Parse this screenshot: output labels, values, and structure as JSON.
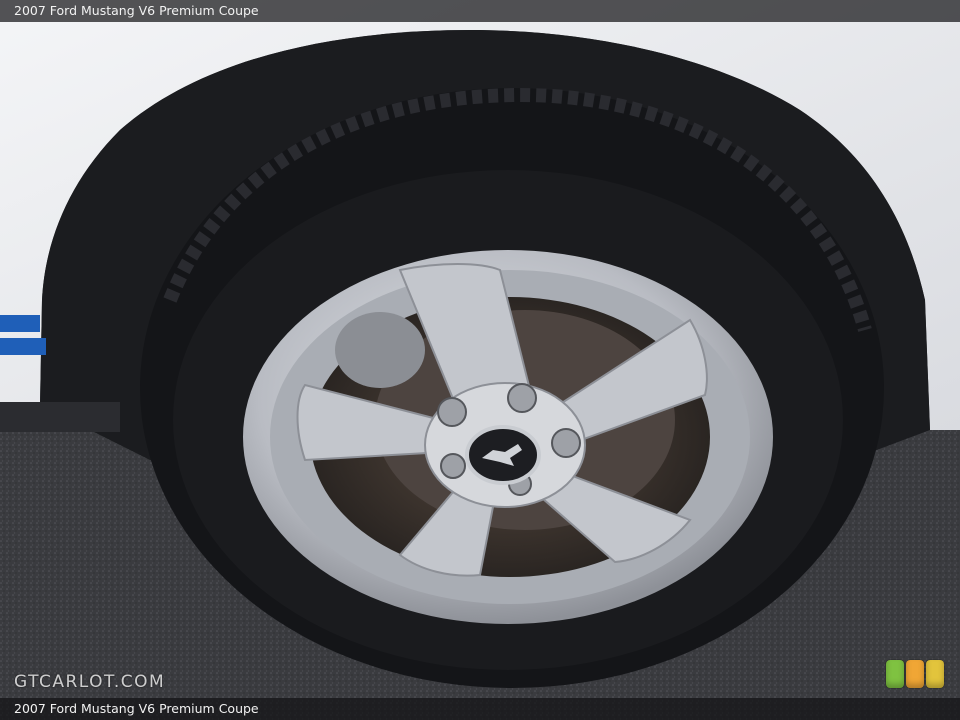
{
  "caption": {
    "title_top": "2007 Ford Mustang V6 Premium Coupe",
    "title_bottom": "2007 Ford Mustang V6 Premium Coupe"
  },
  "watermark": {
    "text": "GTCARLOT.COM"
  },
  "colors": {
    "body_paint": "#ecedf0",
    "stripe": "#1f5fb8",
    "tire": "#141518",
    "rim": "#c4c7cd",
    "asphalt": "#3a3b3f",
    "badge_green": "#7fc241",
    "badge_orange": "#f0a635",
    "badge_yellow": "#e2c43c"
  },
  "badges": [
    {
      "name": "green-badge"
    },
    {
      "name": "orange-badge"
    },
    {
      "name": "yellow-badge"
    }
  ]
}
